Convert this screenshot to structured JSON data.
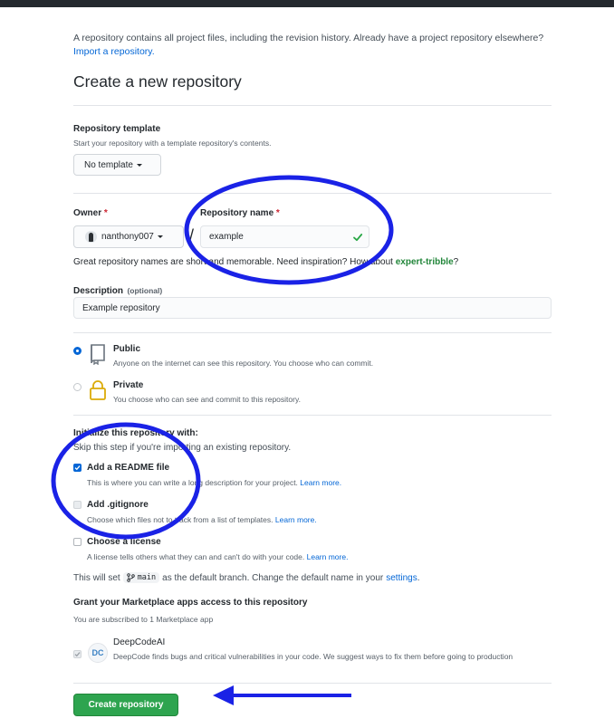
{
  "intro": {
    "text": "A repository contains all project files, including the revision history. Already have a project repository elsewhere?",
    "import_link": "Import a repository."
  },
  "page_title": "Create a new repository",
  "template": {
    "label": "Repository template",
    "hint": "Start your repository with a template repository's contents.",
    "selected": "No template"
  },
  "owner": {
    "label": "Owner",
    "required_mark": "*",
    "value": "nanthony007"
  },
  "separator": "/",
  "repo_name": {
    "label": "Repository name",
    "required_mark": "*",
    "value": "example"
  },
  "name_hint": {
    "text": "Great repository names are short and memorable. Need inspiration? How about",
    "suggestion": "expert-tribble",
    "suffix": "?"
  },
  "description": {
    "label": "Description",
    "optional": "(optional)",
    "value": "Example repository"
  },
  "visibility": [
    {
      "title": "Public",
      "desc": "Anyone on the internet can see this repository. You choose who can commit.",
      "selected": true
    },
    {
      "title": "Private",
      "desc": "You choose who can see and commit to this repository.",
      "selected": false
    }
  ],
  "init": {
    "heading": "Initialize this repository with:",
    "hint": "Skip this step if you're importing an existing repository.",
    "options": [
      {
        "title": "Add a README file",
        "desc": "This is where you can write a long description for your project.",
        "link": "Learn more.",
        "checked": true
      },
      {
        "title": "Add .gitignore",
        "desc": "Choose which files not to track from a list of templates.",
        "link": "Learn more.",
        "checked": false
      },
      {
        "title": "Choose a license",
        "desc": "A license tells others what they can and can't do with your code.",
        "link": "Learn more.",
        "checked": false
      }
    ]
  },
  "branch_note": {
    "prefix": "This will set",
    "branch": "main",
    "middle": "as the default branch. Change the default name in your",
    "link": "settings",
    "suffix": "."
  },
  "marketplace": {
    "heading": "Grant your Marketplace apps access to this repository",
    "subtitle": "You are subscribed to 1 Marketplace app",
    "app": {
      "name": "DeepCodeAI",
      "desc": "DeepCode finds bugs and critical vulnerabilities in your code. We suggest ways to fix them before going to production",
      "logo_text": "DC"
    }
  },
  "submit_label": "Create repository",
  "colors": {
    "primary": "#2ea44f",
    "link": "#0366d6",
    "annotation": "#1a22e6"
  },
  "icons": {
    "repo_public": "repo-icon",
    "repo_private": "lock-icon",
    "branch": "git-branch-icon",
    "check": "check-icon"
  }
}
